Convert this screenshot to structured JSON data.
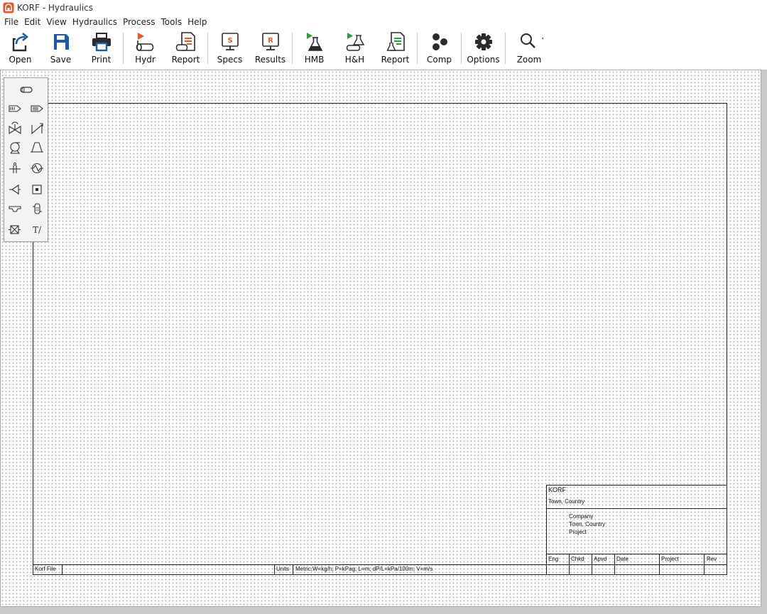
{
  "window": {
    "title": "KORF - Hydraulics",
    "icon": "korf-app-icon"
  },
  "menu": [
    "File",
    "Edit",
    "View",
    "Hydraulics",
    "Process",
    "Tools",
    "Help"
  ],
  "toolbar": {
    "open": "Open",
    "save": "Save",
    "print": "Print",
    "hydr": "Hydr",
    "report1": "Report",
    "specs": "Specs",
    "results": "Results",
    "hmb": "HMB",
    "hh": "H&H",
    "report2": "Report",
    "comp": "Comp",
    "options": "Options",
    "zoom": "Zoom",
    "specs_letter": "S",
    "results_letter": "R"
  },
  "palette": {
    "icons": [
      "pipe-icon",
      "feed-icon",
      "product-icon",
      "valve-icon",
      "control-valve-icon",
      "pump-icon",
      "compressor-icon",
      "orifice-icon",
      "heat-exchanger-icon",
      "nozzle-icon",
      "vessel-icon",
      "tee-icon",
      "column-icon",
      "misc-equipment-icon",
      "text-tool-icon"
    ],
    "text_tool_label": "T/"
  },
  "title_block": {
    "company_header": "KORF",
    "company_location": "Town, Country",
    "client_lines": [
      "Company",
      "Town, Country",
      "Project"
    ],
    "columns": [
      "Eng",
      "Chkd",
      "Apvd",
      "Date",
      "Project",
      "Rev"
    ],
    "korf_file_label": "Korf File",
    "korf_file_value": "",
    "units_label": "Units",
    "units_value": "Metric;W=kg/h; P=kPag; L=m; dP/L=kPa/100m; V=m/s"
  },
  "colors": {
    "accent_blue": "#1f5aa6",
    "accent_orange": "#e8572a",
    "accent_green": "#2e9a3c",
    "icon_dark": "#2b2b2b"
  }
}
